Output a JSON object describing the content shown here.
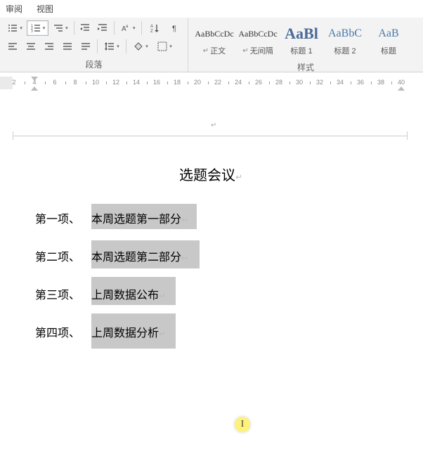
{
  "menu": {
    "review": "审阅",
    "view": "视图"
  },
  "ribbon": {
    "paragraph_label": "段落",
    "styles_label": "样式"
  },
  "styles": [
    {
      "preview": "AaBbCcDc",
      "name": "正文",
      "para": true
    },
    {
      "preview": "AaBbCcDc",
      "name": "无间隔",
      "para": true
    },
    {
      "preview": "AaBl",
      "name": "标题 1",
      "para": false
    },
    {
      "preview": "AaBbC",
      "name": "标题 2",
      "para": false
    },
    {
      "preview": "AaB",
      "name": "标题",
      "para": false
    }
  ],
  "ruler": {
    "start": 2,
    "end": 40,
    "step": 2
  },
  "document": {
    "title": "选题会议",
    "items": [
      {
        "label": "第一项、",
        "text": "本周选题第一部分"
      },
      {
        "label": "第二项、",
        "text": "本周选题第二部分"
      },
      {
        "label": "第三项、",
        "text": "上周数据公布"
      },
      {
        "label": "第四项、",
        "text": "上周数据分析"
      }
    ]
  }
}
